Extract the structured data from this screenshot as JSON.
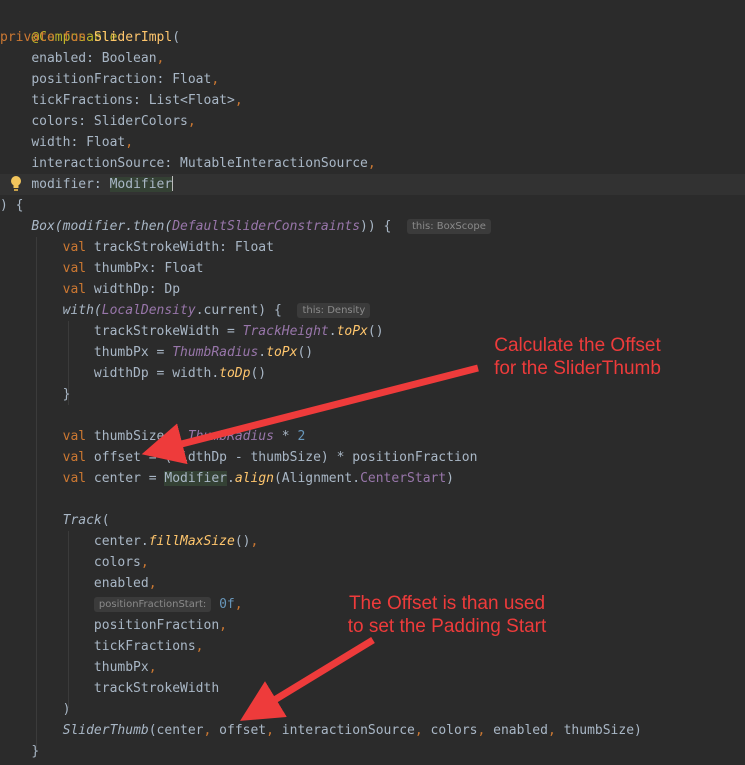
{
  "editor": {
    "lines": {
      "l1": {
        "annotation": "@Composable"
      },
      "l2": {
        "kw1": "private",
        "kw2": "fun",
        "name": "SliderImpl",
        "rest": "("
      },
      "l3": {
        "name": "enabled: Boolean",
        "comma": ","
      },
      "l4": {
        "name": "positionFraction: Float",
        "comma": ","
      },
      "l5": {
        "name": "tickFractions: List<Float>",
        "comma": ","
      },
      "l6": {
        "name": "colors: SliderColors",
        "comma": ","
      },
      "l7": {
        "name": "width: Float",
        "comma": ","
      },
      "l8": {
        "name": "interactionSource: MutableInteractionSource",
        "comma": ","
      },
      "l9": {
        "name": "modifier: ",
        "type": "Modifier"
      },
      "l10": {
        "text": ") {"
      },
      "l11": {
        "a": "Box(modifier.then(",
        "b": "DefaultSliderConstraints",
        "c": ")) {",
        "hint": "this: BoxScope"
      },
      "l12": {
        "kw": "val",
        "rest": " trackStrokeWidth: Float"
      },
      "l13": {
        "kw": "val",
        "rest": " thumbPx: Float"
      },
      "l14": {
        "kw": "val",
        "rest": " widthDp: Dp"
      },
      "l15": {
        "a": "with(",
        "b": "LocalDensity",
        "c": ".current) {",
        "hint": "this: Density"
      },
      "l16": {
        "a": "trackStrokeWidth = ",
        "b": "TrackHeight",
        "c": ".",
        "d": "toPx",
        "e": "()"
      },
      "l17": {
        "a": "thumbPx = ",
        "b": "ThumbRadius",
        "c": ".",
        "d": "toPx",
        "e": "()"
      },
      "l18": {
        "a": "widthDp = width.",
        "d": "toDp",
        "e": "()"
      },
      "l19": {
        "text": "}"
      },
      "l21": {
        "kw": "val",
        "a": " thumbSize = ",
        "b": "ThumbRadius",
        "c": " * ",
        "n": "2"
      },
      "l22": {
        "kw": "val",
        "a": " offset = (widthDp - thumbSize) * positionFraction"
      },
      "l23": {
        "kw": "val",
        "a": " center = ",
        "b": "Modifier",
        "c": ".",
        "d": "align",
        "e": "(Alignment.",
        "f": "CenterStart",
        "g": ")"
      },
      "l25": {
        "a": "Track",
        "b": "("
      },
      "l26": {
        "a": "center.",
        "b": "fillMaxSize",
        "c": "()",
        "comma": ","
      },
      "l27": {
        "a": "colors",
        "comma": ","
      },
      "l28": {
        "a": "enabled",
        "comma": ","
      },
      "l29": {
        "hint": "positionFractionStart:",
        "n": "0f",
        "comma": ","
      },
      "l30": {
        "a": "positionFraction",
        "comma": ","
      },
      "l31": {
        "a": "tickFractions",
        "comma": ","
      },
      "l32": {
        "a": "thumbPx",
        "comma": ","
      },
      "l33": {
        "a": "trackStrokeWidth"
      },
      "l34": {
        "text": ")"
      },
      "l35": {
        "a": "SliderThumb",
        "b": "(center",
        "c1": ", ",
        "d": "offset",
        "c2": ", ",
        "e": "interactionSource",
        "c3": ", ",
        "f": "colors",
        "c4": ", ",
        "g": "enabled",
        "c5": ", ",
        "h": "thumbSize)"
      },
      "l36": {
        "text": "}"
      }
    }
  },
  "annotations": {
    "offset_callout": "Calculate the Offset\nfor the SliderThumb",
    "padding_callout": "The Offset is than used\nto set the Padding Start"
  },
  "colors": {
    "arrow": "#ee3b3b",
    "background": "#2b2b2b",
    "keyword": "#cc7832",
    "function": "#ffc66d"
  },
  "icons": {
    "gutter": "lightbulb-icon"
  }
}
